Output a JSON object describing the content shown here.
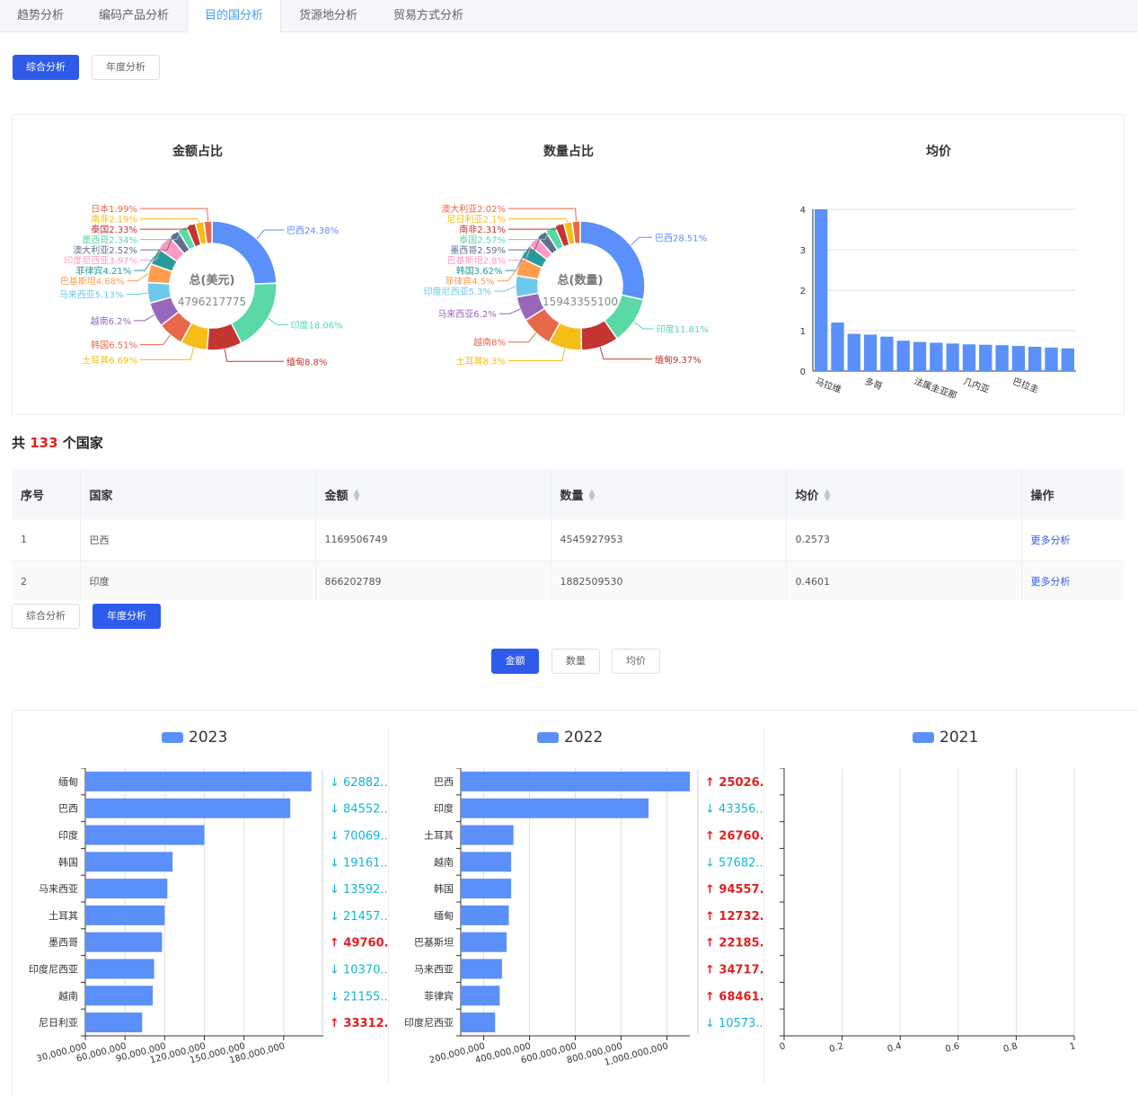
{
  "tabs": [
    "趋势分析",
    "编码产品分析",
    "目的国分析",
    "货源地分析",
    "贸易方式分析"
  ],
  "active_tab": 2,
  "mode_buttons": {
    "combined": "综合分析",
    "yearly": "年度分析"
  },
  "metric_buttons": {
    "amount": "金额",
    "quantity": "数量",
    "avg": "均价"
  },
  "colors": {
    "primary": "#2f5bea",
    "bar": "#5b8ff9",
    "up": "#e02020",
    "down": "#13b5d6"
  },
  "summary": {
    "prefix": "共",
    "count": "133",
    "suffix": "个国家"
  },
  "table": {
    "headers": [
      "序号",
      "国家",
      "金额",
      "数量",
      "均价",
      "操作"
    ],
    "rows": [
      [
        "1",
        "巴西",
        "1169506749",
        "4545927953",
        "0.2573",
        "更多分析"
      ],
      [
        "2",
        "印度",
        "866202789",
        "1882509530",
        "0.4601",
        "更多分析"
      ]
    ]
  },
  "chart_data": [
    {
      "type": "pie",
      "title": "金额占比",
      "center_label": "总(美元)",
      "center_value": "4796217775",
      "slices": [
        {
          "name": "巴西",
          "value": 24.38,
          "label": "巴西24.38%",
          "color": "#5b8ff9"
        },
        {
          "name": "印度",
          "value": 18.06,
          "label": "印度18.06%",
          "color": "#5ad8a6"
        },
        {
          "name": "缅甸",
          "value": 8.8,
          "label": "缅甸8.8%",
          "color": "#c23531"
        },
        {
          "name": "土耳其",
          "value": 6.69,
          "label": "土耳其6.69%",
          "color": "#f6bd16"
        },
        {
          "name": "韩国",
          "value": 6.51,
          "label": "韩国6.51%",
          "color": "#e8684a"
        },
        {
          "name": "越南",
          "value": 6.2,
          "label": "越南6.2%",
          "color": "#9867bc"
        },
        {
          "name": "马来西亚",
          "value": 5.13,
          "label": "马来西亚5.13%",
          "color": "#6dc8ec"
        },
        {
          "name": "巴基斯坦",
          "value": 4.68,
          "label": "巴基斯坦4.68%",
          "color": "#ff9d4d"
        },
        {
          "name": "菲律宾",
          "value": 4.21,
          "label": "菲律宾4.21%",
          "color": "#269a99"
        },
        {
          "name": "印度尼西亚",
          "value": 3.97,
          "label": "印度尼西亚3.97%",
          "color": "#ff99c3"
        },
        {
          "name": "澳大利亚",
          "value": 2.52,
          "label": "澳大利亚2.52%",
          "color": "#5d7092"
        },
        {
          "name": "墨西哥",
          "value": 2.34,
          "label": "墨西哥2.34%",
          "color": "#5ad8a6"
        },
        {
          "name": "泰国",
          "value": 2.33,
          "label": "泰国2.33%",
          "color": "#c23531"
        },
        {
          "name": "南非",
          "value": 2.19,
          "label": "南非2.19%",
          "color": "#f6bd16"
        },
        {
          "name": "日本",
          "value": 1.99,
          "label": "日本1.99%",
          "color": "#e8684a"
        }
      ]
    },
    {
      "type": "pie",
      "title": "数量占比",
      "center_label": "总(数量)",
      "center_value": "15943355100",
      "slices": [
        {
          "name": "巴西",
          "value": 28.51,
          "label": "巴西28.51%",
          "color": "#5b8ff9"
        },
        {
          "name": "印度",
          "value": 11.81,
          "label": "印度11.81%",
          "color": "#5ad8a6"
        },
        {
          "name": "缅甸",
          "value": 9.37,
          "label": "缅甸9.37%",
          "color": "#c23531"
        },
        {
          "name": "土耳其",
          "value": 8.3,
          "label": "土耳其8.3%",
          "color": "#f6bd16"
        },
        {
          "name": "越南",
          "value": 8,
          "label": "越南8%",
          "color": "#e8684a"
        },
        {
          "name": "马来西亚",
          "value": 6.2,
          "label": "马来西亚6.2%",
          "color": "#9867bc"
        },
        {
          "name": "印度尼西亚",
          "value": 5.3,
          "label": "印度尼西亚5.3%",
          "color": "#6dc8ec"
        },
        {
          "name": "菲律宾",
          "value": 4.5,
          "label": "菲律宾4.5%",
          "color": "#ff9d4d"
        },
        {
          "name": "韩国",
          "value": 3.62,
          "label": "韩国3.62%",
          "color": "#269a99"
        },
        {
          "name": "巴基斯坦",
          "value": 2.8,
          "label": "巴基斯坦2.8%",
          "color": "#ff99c3"
        },
        {
          "name": "墨西哥",
          "value": 2.59,
          "label": "墨西哥2.59%",
          "color": "#5d7092"
        },
        {
          "name": "泰国",
          "value": 2.57,
          "label": "泰国2.57%",
          "color": "#5ad8a6"
        },
        {
          "name": "南非",
          "value": 2.31,
          "label": "南非2.31%",
          "color": "#c23531"
        },
        {
          "name": "尼日利亚",
          "value": 2.1,
          "label": "尼日利亚2.1%",
          "color": "#f6bd16"
        },
        {
          "name": "澳大利亚",
          "value": 2.02,
          "label": "澳大利亚2.02%",
          "color": "#e8684a"
        }
      ]
    },
    {
      "type": "bar",
      "title": "均价",
      "values": [
        4.0,
        1.2,
        0.92,
        0.9,
        0.85,
        0.75,
        0.72,
        0.7,
        0.68,
        0.66,
        0.65,
        0.64,
        0.62,
        0.6,
        0.58,
        0.56
      ],
      "tick_labels": [
        {
          "index": 0,
          "text": "马拉维"
        },
        {
          "index": 3,
          "text": "多哥"
        },
        {
          "index": 6,
          "text": "法属圭亚那"
        },
        {
          "index": 9,
          "text": "几内亚"
        },
        {
          "index": 12,
          "text": "巴拉圭"
        }
      ],
      "ylim": [
        0,
        4
      ],
      "yticks": [
        "0",
        "1",
        "2",
        "3",
        "4"
      ]
    },
    {
      "type": "bar",
      "orientation": "horizontal",
      "series_name": "2023",
      "categories": [
        "缅甸",
        "巴西",
        "印度",
        "韩国",
        "马来西亚",
        "土耳其",
        "墨西哥",
        "印度尼西亚",
        "越南",
        "尼日利亚"
      ],
      "values": [
        201000000,
        185000000,
        120000000,
        96000000,
        92000000,
        90000000,
        88000000,
        82000000,
        81000000,
        73000000
      ],
      "xlim": [
        30000000,
        210000000
      ],
      "xticks": [
        "30,000,000",
        "60,000,000",
        "90,000,000",
        "120,000,000",
        "150,000,000",
        "180,000,000"
      ],
      "changes": [
        {
          "dir": "down",
          "text": "↓ 62882.."
        },
        {
          "dir": "down",
          "text": "↓ 84552.."
        },
        {
          "dir": "down",
          "text": "↓ 70069.."
        },
        {
          "dir": "down",
          "text": "↓ 19161.."
        },
        {
          "dir": "down",
          "text": "↓ 13592.."
        },
        {
          "dir": "down",
          "text": "↓ 21457.."
        },
        {
          "dir": "up",
          "text": "↑ 49760.."
        },
        {
          "dir": "down",
          "text": "↓ 10370.."
        },
        {
          "dir": "down",
          "text": "↓ 21155.."
        },
        {
          "dir": "up",
          "text": "↑ 33312.."
        }
      ]
    },
    {
      "type": "bar",
      "orientation": "horizontal",
      "series_name": "2022",
      "categories": [
        "巴西",
        "印度",
        "土耳其",
        "越南",
        "韩国",
        "缅甸",
        "巴基斯坦",
        "马来西亚",
        "菲律宾",
        "印度尼西亚"
      ],
      "values": [
        1100000000,
        920000000,
        330000000,
        320000000,
        320000000,
        310000000,
        300000000,
        280000000,
        270000000,
        250000000
      ],
      "xlim": [
        100000000,
        1100000000
      ],
      "xticks": [
        "200,000,000",
        "400,000,000",
        "600,000,000",
        "800,000,000",
        "1,000,000,000"
      ],
      "changes": [
        {
          "dir": "up",
          "text": "↑ 25026.."
        },
        {
          "dir": "down",
          "text": "↓ 43356.."
        },
        {
          "dir": "up",
          "text": "↑ 26760.."
        },
        {
          "dir": "down",
          "text": "↓ 57682.."
        },
        {
          "dir": "up",
          "text": "↑ 94557.."
        },
        {
          "dir": "up",
          "text": "↑ 12732.."
        },
        {
          "dir": "up",
          "text": "↑ 22185.."
        },
        {
          "dir": "up",
          "text": "↑ 34717.."
        },
        {
          "dir": "up",
          "text": "↑ 68461.."
        },
        {
          "dir": "down",
          "text": "↓ 10573.."
        }
      ]
    },
    {
      "type": "bar",
      "orientation": "horizontal",
      "series_name": "2021",
      "categories": [],
      "values": [],
      "xlim": [
        0,
        1
      ],
      "xticks": [
        "0",
        "0.2",
        "0.4",
        "0.6",
        "0.8",
        "1"
      ]
    }
  ]
}
